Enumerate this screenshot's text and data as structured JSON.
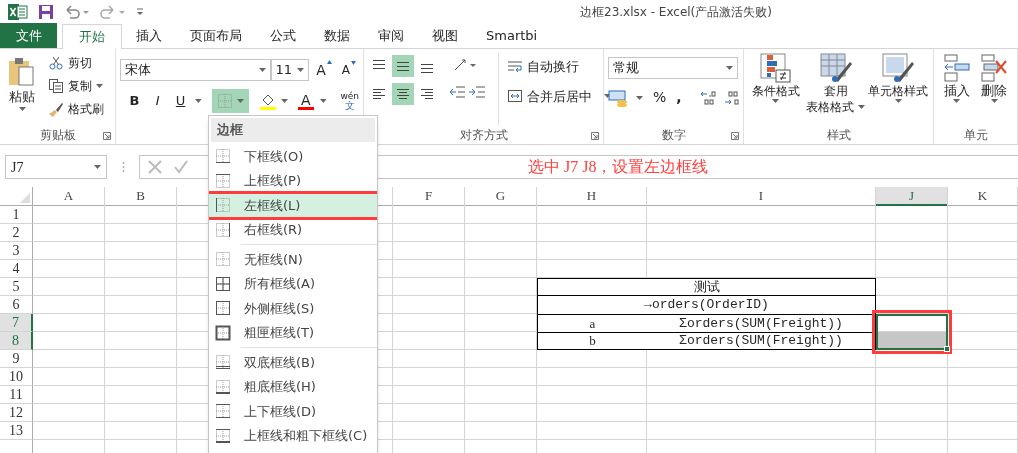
{
  "window": {
    "title": "边框23.xlsx - Excel(产品激活失败)"
  },
  "tabs": [
    {
      "label": "文件",
      "kind": "file",
      "selected": false
    },
    {
      "label": "开始",
      "kind": "tab",
      "selected": true
    },
    {
      "label": "插入",
      "kind": "tab",
      "selected": false
    },
    {
      "label": "页面布局",
      "kind": "tab",
      "selected": false
    },
    {
      "label": "公式",
      "kind": "tab",
      "selected": false
    },
    {
      "label": "数据",
      "kind": "tab",
      "selected": false
    },
    {
      "label": "审阅",
      "kind": "tab",
      "selected": false
    },
    {
      "label": "视图",
      "kind": "tab",
      "selected": false
    },
    {
      "label": "Smartbi",
      "kind": "tab",
      "selected": false
    }
  ],
  "ribbon": {
    "clipboard": {
      "paste": "粘贴",
      "cut": "剪切",
      "copy": "复制",
      "format_painter": "格式刷",
      "label": "剪贴板"
    },
    "font": {
      "name": "宋体",
      "size": "11",
      "grow": "A",
      "shrink": "A",
      "bold": "B",
      "italic": "I",
      "underline": "U",
      "borders_open": true,
      "font_color": "A",
      "phonetic_top": "wén",
      "phonetic_bottom": "文"
    },
    "alignment": {
      "vertical": [
        {
          "kind": "top",
          "selected": false
        },
        {
          "kind": "middle",
          "selected": true
        },
        {
          "kind": "bottom",
          "selected": false
        }
      ],
      "horizontal": [
        {
          "kind": "left",
          "selected": false
        },
        {
          "kind": "center",
          "selected": true
        },
        {
          "kind": "right",
          "selected": false
        }
      ],
      "wrap": "自动换行",
      "merge": "合并后居中",
      "label": "对齐方式"
    },
    "number": {
      "format": "常规",
      "percent": "%",
      "comma": ",",
      "label": "数字"
    },
    "styles": {
      "conditional": "条件格式",
      "table_line1": "套用",
      "table_line2": "表格格式",
      "cell_styles": "单元格样式",
      "label": "样式"
    },
    "cells": {
      "insert": "插入",
      "delete": "删除",
      "label": "单元"
    }
  },
  "formula_bar": {
    "name_box": "J7"
  },
  "annotation": "选中 J7 J8，设置左边框线",
  "sheet": {
    "columns": [
      {
        "label": "A",
        "selected": false
      },
      {
        "label": "B",
        "selected": false
      },
      {
        "label": "F",
        "selected": false
      },
      {
        "label": "G",
        "selected": false
      },
      {
        "label": "H",
        "selected": false
      },
      {
        "label": "I",
        "selected": false
      },
      {
        "label": "J",
        "selected": true
      },
      {
        "label": "K",
        "selected": false
      }
    ],
    "rows": [
      {
        "label": "1",
        "selected": false
      },
      {
        "label": "2",
        "selected": false
      },
      {
        "label": "3",
        "selected": false
      },
      {
        "label": "4",
        "selected": false
      },
      {
        "label": "5",
        "selected": false
      },
      {
        "label": "6",
        "selected": false
      },
      {
        "label": "7",
        "selected": true
      },
      {
        "label": "8",
        "selected": true
      },
      {
        "label": "9",
        "selected": false
      },
      {
        "label": "10",
        "selected": false
      },
      {
        "label": "11",
        "selected": false
      },
      {
        "label": "12",
        "selected": false
      },
      {
        "label": "13",
        "selected": false
      }
    ],
    "table": {
      "title": "测试",
      "subtitle": "→orders(OrderID)",
      "rows": [
        {
          "label": "a",
          "value": "Σorders(SUM(Freight))"
        },
        {
          "label": "b",
          "value": "Σorders(SUM(Freight))"
        }
      ]
    }
  },
  "border_menu": {
    "title": "边框",
    "sections": [
      [
        {
          "label": "下框线(O)",
          "kind": "bottom",
          "selected": false
        },
        {
          "label": "上框线(P)",
          "kind": "top",
          "selected": false
        },
        {
          "label": "左框线(L)",
          "kind": "left",
          "selected": true
        },
        {
          "label": "右框线(R)",
          "kind": "right",
          "selected": false
        }
      ],
      [
        {
          "label": "无框线(N)",
          "kind": "none",
          "selected": false
        },
        {
          "label": "所有框线(A)",
          "kind": "all",
          "selected": false
        },
        {
          "label": "外侧框线(S)",
          "kind": "outside",
          "selected": false
        },
        {
          "label": "粗匣框线(T)",
          "kind": "thick_box",
          "selected": false
        }
      ],
      [
        {
          "label": "双底框线(B)",
          "kind": "double_bottom",
          "selected": false
        },
        {
          "label": "粗底框线(H)",
          "kind": "thick_bottom",
          "selected": false
        },
        {
          "label": "上下框线(D)",
          "kind": "top_bottom",
          "selected": false
        },
        {
          "label": "上框线和粗下框线(C)",
          "kind": "top_thick_bottom",
          "selected": false
        }
      ]
    ]
  }
}
